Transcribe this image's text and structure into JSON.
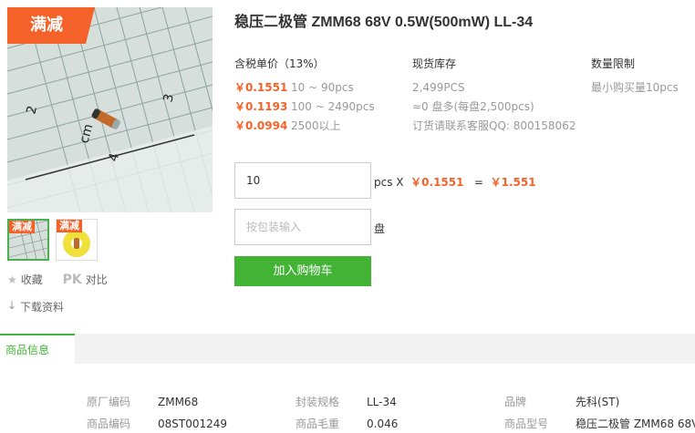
{
  "badge": "满减",
  "thumb_badges": [
    "满减",
    "满减"
  ],
  "actions": {
    "favorite": "收藏",
    "pk": "PK",
    "compare": "对比",
    "download": "下载资料"
  },
  "title": "稳压二极管 ZMM68 68V 0.5W(500mW) LL-34",
  "price_header": "含税单价（13%）",
  "prices": [
    {
      "price": "￥0.1551",
      "range": "10 ~ 90pcs"
    },
    {
      "price": "￥0.1193",
      "range": "100 ~ 2490pcs"
    },
    {
      "price": "￥0.0994",
      "range": "2500以上"
    }
  ],
  "stock_header": "现货库存",
  "stock": [
    "2,499PCS",
    "≈0 盘多(每盘2,500pcs)",
    "订货请联系客服QQ: 800158062"
  ],
  "limit_header": "数量限制",
  "limit": "最小购买量10pcs",
  "quantity_value": "10",
  "calc": {
    "unit": "pcs X",
    "unit_price": "￥0.1551",
    "eq": "=",
    "total": "￥1.551"
  },
  "pack_placeholder": "按包装输入",
  "pack_unit": "盘",
  "cart_button": "加入购物车",
  "info_tab": "商品信息",
  "specs": [
    {
      "k": "原厂编码",
      "v": "ZMM68"
    },
    {
      "k": "封装规格",
      "v": "LL-34"
    },
    {
      "k": "品牌",
      "v": "先科(ST)"
    },
    {
      "k": "商品编码",
      "v": "08ST001249"
    },
    {
      "k": "商品毛重",
      "v": "0.046"
    },
    {
      "k": "商品型号",
      "v": "稳压二极管 ZMM68 68V"
    }
  ],
  "colors": {
    "accent": "#f4622a",
    "green": "#43b336"
  }
}
